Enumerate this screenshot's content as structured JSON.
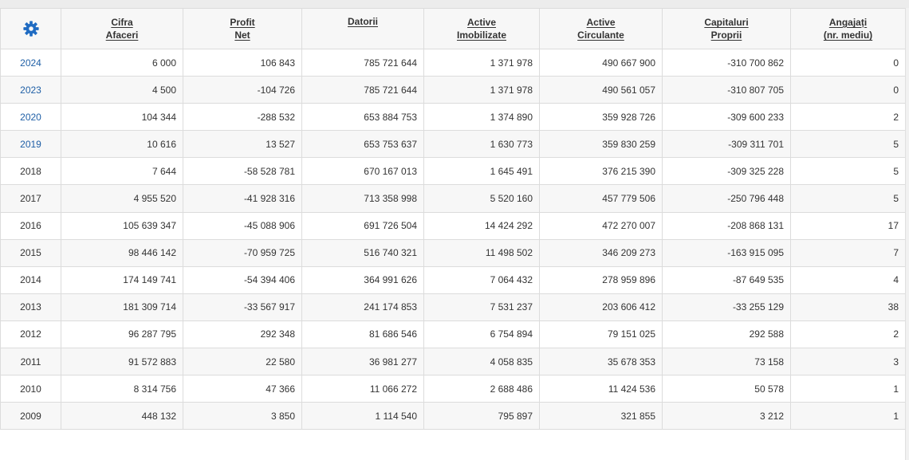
{
  "header": {
    "columns": [
      {
        "l1": "Cifra",
        "l2": "Afaceri"
      },
      {
        "l1": "Profit",
        "l2": "Net"
      },
      {
        "l1": "Datorii",
        "l2": ""
      },
      {
        "l1": "Active",
        "l2": "Imobilizate"
      },
      {
        "l1": "Active",
        "l2": "Circulante"
      },
      {
        "l1": "Capitaluri",
        "l2": "Proprii"
      },
      {
        "l1": "Angajați",
        "l2": "(nr. mediu)"
      }
    ]
  },
  "icons": {
    "settings": "gear-icon",
    "color": "#1f6bc2"
  },
  "colors": {
    "link": "#1f5fa6",
    "border": "#dcdcdc",
    "stripe": "#f7f7f7"
  },
  "rows": [
    {
      "year": "2024",
      "link": true,
      "cifra": "6 000",
      "profit": "106 843",
      "datorii": "785 721 644",
      "imob": "1 371 978",
      "circ": "490 667 900",
      "cap": "-310 700 862",
      "ang": "0"
    },
    {
      "year": "2023",
      "link": true,
      "cifra": "4 500",
      "profit": "-104 726",
      "datorii": "785 721 644",
      "imob": "1 371 978",
      "circ": "490 561 057",
      "cap": "-310 807 705",
      "ang": "0"
    },
    {
      "year": "2020",
      "link": true,
      "cifra": "104 344",
      "profit": "-288 532",
      "datorii": "653 884 753",
      "imob": "1 374 890",
      "circ": "359 928 726",
      "cap": "-309 600 233",
      "ang": "2"
    },
    {
      "year": "2019",
      "link": true,
      "cifra": "10 616",
      "profit": "13 527",
      "datorii": "653 753 637",
      "imob": "1 630 773",
      "circ": "359 830 259",
      "cap": "-309 311 701",
      "ang": "5"
    },
    {
      "year": "2018",
      "link": false,
      "cifra": "7 644",
      "profit": "-58 528 781",
      "datorii": "670 167 013",
      "imob": "1 645 491",
      "circ": "376 215 390",
      "cap": "-309 325 228",
      "ang": "5"
    },
    {
      "year": "2017",
      "link": false,
      "cifra": "4 955 520",
      "profit": "-41 928 316",
      "datorii": "713 358 998",
      "imob": "5 520 160",
      "circ": "457 779 506",
      "cap": "-250 796 448",
      "ang": "5"
    },
    {
      "year": "2016",
      "link": false,
      "cifra": "105 639 347",
      "profit": "-45 088 906",
      "datorii": "691 726 504",
      "imob": "14 424 292",
      "circ": "472 270 007",
      "cap": "-208 868 131",
      "ang": "17"
    },
    {
      "year": "2015",
      "link": false,
      "cifra": "98 446 142",
      "profit": "-70 959 725",
      "datorii": "516 740 321",
      "imob": "11 498 502",
      "circ": "346 209 273",
      "cap": "-163 915 095",
      "ang": "7"
    },
    {
      "year": "2014",
      "link": false,
      "cifra": "174 149 741",
      "profit": "-54 394 406",
      "datorii": "364 991 626",
      "imob": "7 064 432",
      "circ": "278 959 896",
      "cap": "-87 649 535",
      "ang": "4"
    },
    {
      "year": "2013",
      "link": false,
      "cifra": "181 309 714",
      "profit": "-33 567 917",
      "datorii": "241 174 853",
      "imob": "7 531 237",
      "circ": "203 606 412",
      "cap": "-33 255 129",
      "ang": "38"
    },
    {
      "year": "2012",
      "link": false,
      "cifra": "96 287 795",
      "profit": "292 348",
      "datorii": "81 686 546",
      "imob": "6 754 894",
      "circ": "79 151 025",
      "cap": "292 588",
      "ang": "2"
    },
    {
      "year": "2011",
      "link": false,
      "cifra": "91 572 883",
      "profit": "22 580",
      "datorii": "36 981 277",
      "imob": "4 058 835",
      "circ": "35 678 353",
      "cap": "73 158",
      "ang": "3"
    },
    {
      "year": "2010",
      "link": false,
      "cifra": "8 314 756",
      "profit": "47 366",
      "datorii": "11 066 272",
      "imob": "2 688 486",
      "circ": "11 424 536",
      "cap": "50 578",
      "ang": "1"
    },
    {
      "year": "2009",
      "link": false,
      "cifra": "448 132",
      "profit": "3 850",
      "datorii": "1 114 540",
      "imob": "795 897",
      "circ": "321 855",
      "cap": "3 212",
      "ang": "1"
    }
  ]
}
